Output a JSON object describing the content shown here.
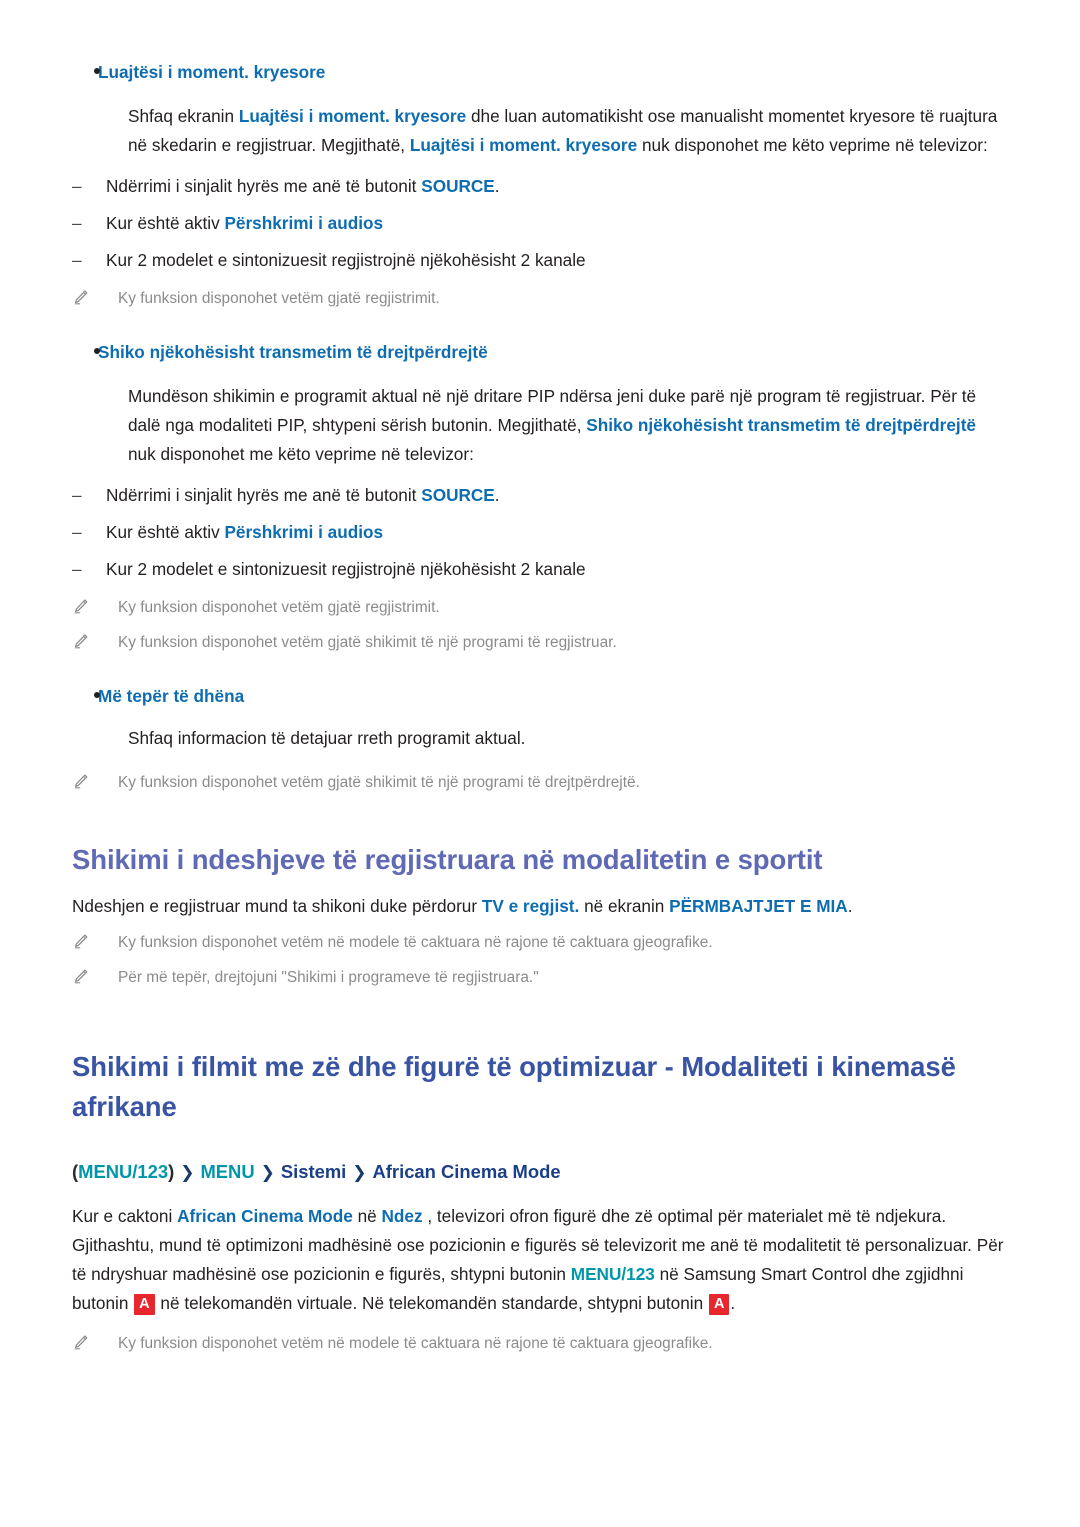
{
  "colors": {
    "keyword_blue": "#0e6db1",
    "keyword_teal": "#0096a9",
    "heading_violet": "#6069b4",
    "heading_navy": "#3a54a4",
    "body_text": "#231f20",
    "note_text": "#8b8b8b",
    "keycap_red": "#e8262d"
  },
  "section_highlight": {
    "bullet_label": "Luajtësi i moment. kryesore",
    "paragraph": {
      "t1": "Shfaq ekranin ",
      "kw1": "Luajtësi i moment. kryesore",
      "t2": " dhe luan automatikisht ose manualisht momentet kryesore të ruajtura në skedarin e regjistruar. Megjithatë, ",
      "kw2": "Luajtësi i moment. kryesore",
      "t3": " nuk disponohet me këto veprime në televizor:"
    },
    "dash_items": [
      {
        "pre": "Ndërrimi i sinjalit hyrës me anë të butonit ",
        "kw": "SOURCE",
        "post": "."
      },
      {
        "pre": "Kur është aktiv ",
        "kw": "Përshkrimi i audios",
        "post": ""
      },
      {
        "pre": "Kur 2 modelet e sintonizuesit regjistrojnë njëkohësisht 2 kanale",
        "kw": "",
        "post": ""
      }
    ],
    "notes": [
      "Ky funksion disponohet vetëm gjatë regjistrimit."
    ]
  },
  "section_pip": {
    "bullet_label": "Shiko njëkohësisht transmetim të drejtpërdrejtë",
    "paragraph": {
      "t1": "Mundëson shikimin e programit aktual në një dritare PIP ndërsa jeni duke parë një program të regjistruar. Për të dalë nga modaliteti PIP, shtypeni sërish butonin. Megjithatë, ",
      "kw1": "Shiko njëkohësisht transmetim të drejtpërdrejtë",
      "t2": " nuk disponohet me këto veprime në televizor:"
    },
    "dash_items": [
      {
        "pre": "Ndërrimi i sinjalit hyrës me anë të butonit ",
        "kw": "SOURCE",
        "post": "."
      },
      {
        "pre": "Kur është aktiv ",
        "kw": "Përshkrimi i audios",
        "post": ""
      },
      {
        "pre": "Kur 2 modelet e sintonizuesit regjistrojnë njëkohësisht 2 kanale",
        "kw": "",
        "post": ""
      }
    ],
    "notes": [
      "Ky funksion disponohet vetëm gjatë regjistrimit.",
      "Ky funksion disponohet vetëm gjatë shikimit të një programi të regjistruar."
    ]
  },
  "section_moreinfo": {
    "bullet_label": "Më tepër të dhëna",
    "paragraph": "Shfaq informacion të detajuar rreth programit aktual.",
    "notes": [
      "Ky funksion disponohet vetëm gjatë shikimit të një programi të drejtpërdrejtë."
    ]
  },
  "section_sports": {
    "heading": "Shikimi i ndeshjeve të regjistruara në modalitetin e sportit",
    "paragraph": {
      "t1": "Ndeshjen e regjistruar mund ta shikoni duke përdorur ",
      "kw1": "TV e regjist.",
      "t2": " në ekranin ",
      "kw2": "PËRMBAJTJET E MIA",
      "t3": "."
    },
    "notes": [
      "Ky funksion disponohet vetëm në modele të caktuara në rajone të caktuara gjeografike.",
      "Për më tepër, drejtojuni \"Shikimi i programeve të regjistruara.\""
    ]
  },
  "section_african": {
    "heading": "Shikimi i filmit me zë dhe figurë të optimizuar - Modaliteti i kinemasë afrikane",
    "path": {
      "open_paren": "(",
      "item1": "MENU/123",
      "close_paren": ")",
      "chevron": "❯",
      "item2": "MENU",
      "item3": "Sistemi",
      "item4": "African Cinema Mode"
    },
    "paragraph": {
      "t1": "Kur e caktoni ",
      "kw1": "African Cinema Mode",
      "t2": " në ",
      "kw2": "Ndez",
      "t3": " , televizori ofron figurë dhe zë optimal për materialet më të ndjekura. Gjithashtu, mund të optimizoni madhësinë ose pozicionin e figurës së televizorit me anë të modalitetit të personalizuar. Për të ndryshuar madhësinë ose pozicionin e figurës, shtypni butonin ",
      "kw3": "MENU/123",
      "t4": " në Samsung Smart Control dhe zgjidhni butonin ",
      "keycap1": "A",
      "t5": " në telekomandën virtuale. Në telekomandën standarde, shtypni butonin ",
      "keycap2": "A",
      "t6": "."
    },
    "notes": [
      "Ky funksion disponohet vetëm në modele të caktuara në rajone të caktuara gjeografike."
    ]
  },
  "icons": {
    "pencil": "pencil-icon",
    "bullet": "bullet-dot-icon",
    "dash": "–",
    "chevron": "chevron-right-icon"
  }
}
